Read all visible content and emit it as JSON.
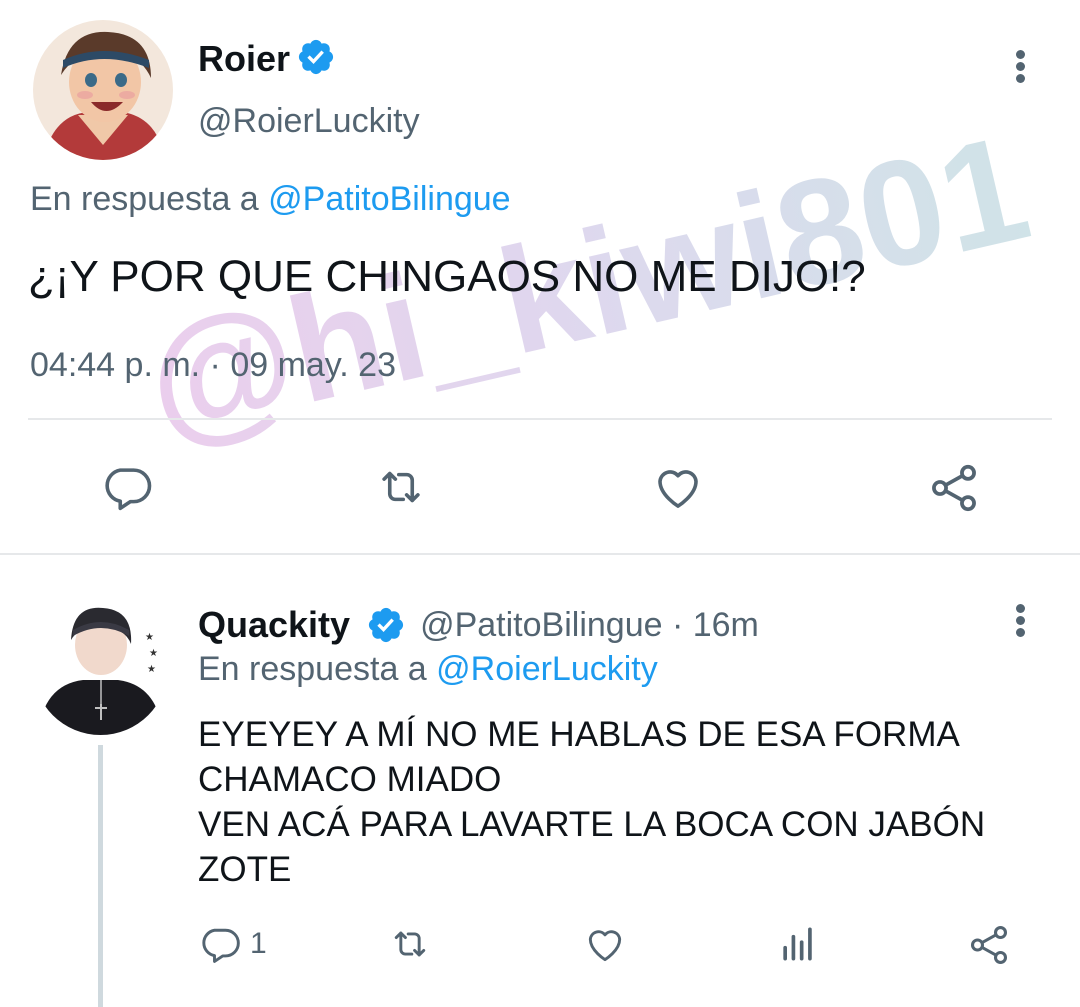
{
  "main_tweet": {
    "display_name": "Roier",
    "handle": "@RoierLuckity",
    "reply_prefix": "En respuesta a",
    "reply_to": "@PatitoBilingue",
    "text": "¿¡Y POR QUE CHINGAOS NO ME DIJO!?",
    "timestamp": "04:44 p. m. · 09 may. 23",
    "actions": [
      "reply-icon",
      "retweet-icon",
      "like-icon",
      "share-icon"
    ]
  },
  "reply_tweet": {
    "display_name": "Quackity",
    "handle_time": "@PatitoBilingue · 16m",
    "reply_prefix": "En respuesta a",
    "reply_to": "@RoierLuckity",
    "lines": [
      "EYEYEY A MÍ NO ME HABLAS DE ESA FORMA",
      "CHAMACO MIADO",
      "VEN ACÁ PARA LAVARTE LA BOCA CON JABÓN",
      "ZOTE"
    ],
    "reply_count": "1",
    "actions": [
      "reply-icon",
      "retweet-icon",
      "like-icon",
      "analytics-icon",
      "share-icon"
    ]
  },
  "watermark": "@hi_kiwi801",
  "colors": {
    "link": "#1d9bf0",
    "secondary_text": "#536471",
    "verified": "#1d9bf0",
    "divider": "#e6e8ea"
  }
}
